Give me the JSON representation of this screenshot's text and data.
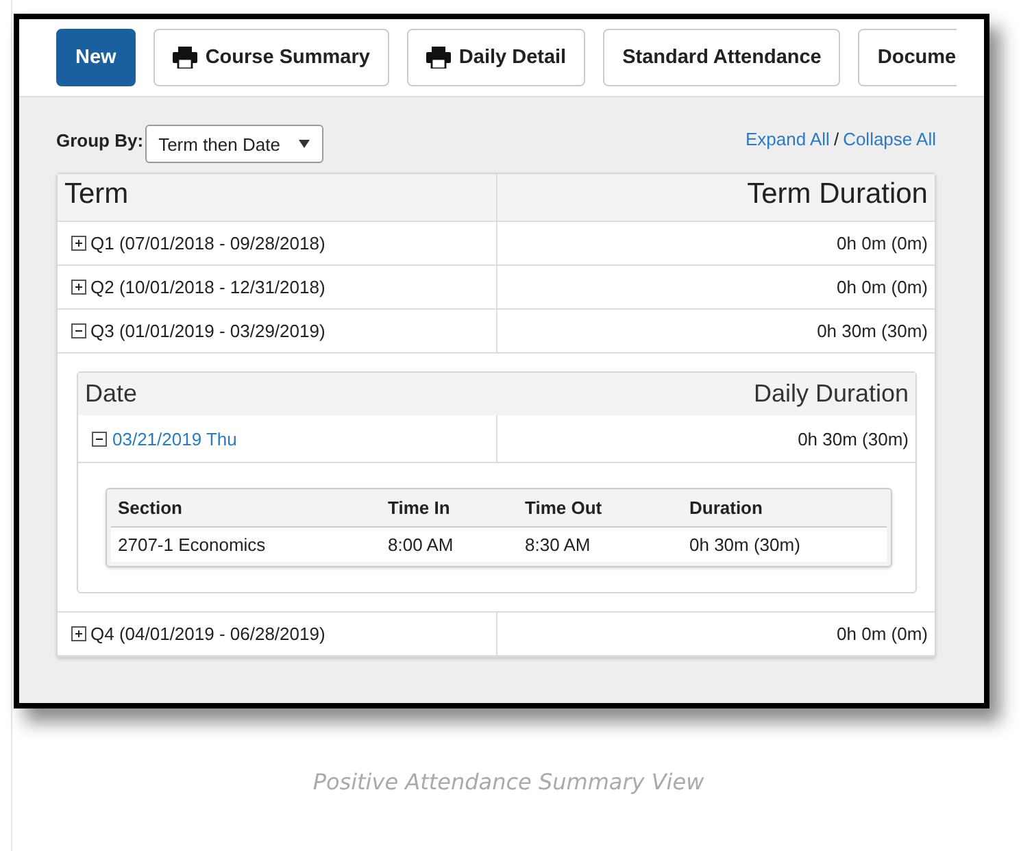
{
  "toolbar": {
    "buttons": [
      {
        "label": "New",
        "kind": "primary"
      },
      {
        "label": "Course Summary",
        "kind": "print"
      },
      {
        "label": "Daily Detail",
        "kind": "print"
      },
      {
        "label": "Standard Attendance",
        "kind": "plain"
      },
      {
        "label": "Docume",
        "kind": "cut"
      }
    ]
  },
  "group_by": {
    "label": "Group By:",
    "value": "Term then Date"
  },
  "links": [
    {
      "label": "Expand All"
    },
    {
      "label": "Collapse All"
    }
  ],
  "link_separator": "/",
  "table": {
    "columns": [
      "Term",
      "Term Duration"
    ],
    "rows": [
      {
        "label": "Q1 (07/01/2018 - 09/28/2018)",
        "duration": "0h 0m (0m)",
        "expanded": false
      },
      {
        "label": "Q2 (10/01/2018 - 12/31/2018)",
        "duration": "0h 0m (0m)",
        "expanded": false
      },
      {
        "label": "Q3 (01/01/2019 - 03/29/2019)",
        "duration": "0h 30m (30m)",
        "expanded": true,
        "detail": {
          "columns": [
            "Date",
            "Daily Duration"
          ],
          "rows": [
            {
              "label": "03/21/2019 Thu",
              "duration": "0h 30m (30m)",
              "expanded": true,
              "sections": {
                "columns": [
                  "Section",
                  "Time In",
                  "Time Out",
                  "Duration"
                ],
                "rows": [
                  [
                    "2707-1 Economics",
                    "8:00 AM",
                    "8:30 AM",
                    "0h 30m (30m)"
                  ]
                ]
              }
            }
          ]
        }
      },
      {
        "label": "Q4 (04/01/2019 - 06/28/2019)",
        "duration": "0h 0m (0m)",
        "expanded": false
      }
    ]
  },
  "caption": "Positive Attendance Summary View"
}
